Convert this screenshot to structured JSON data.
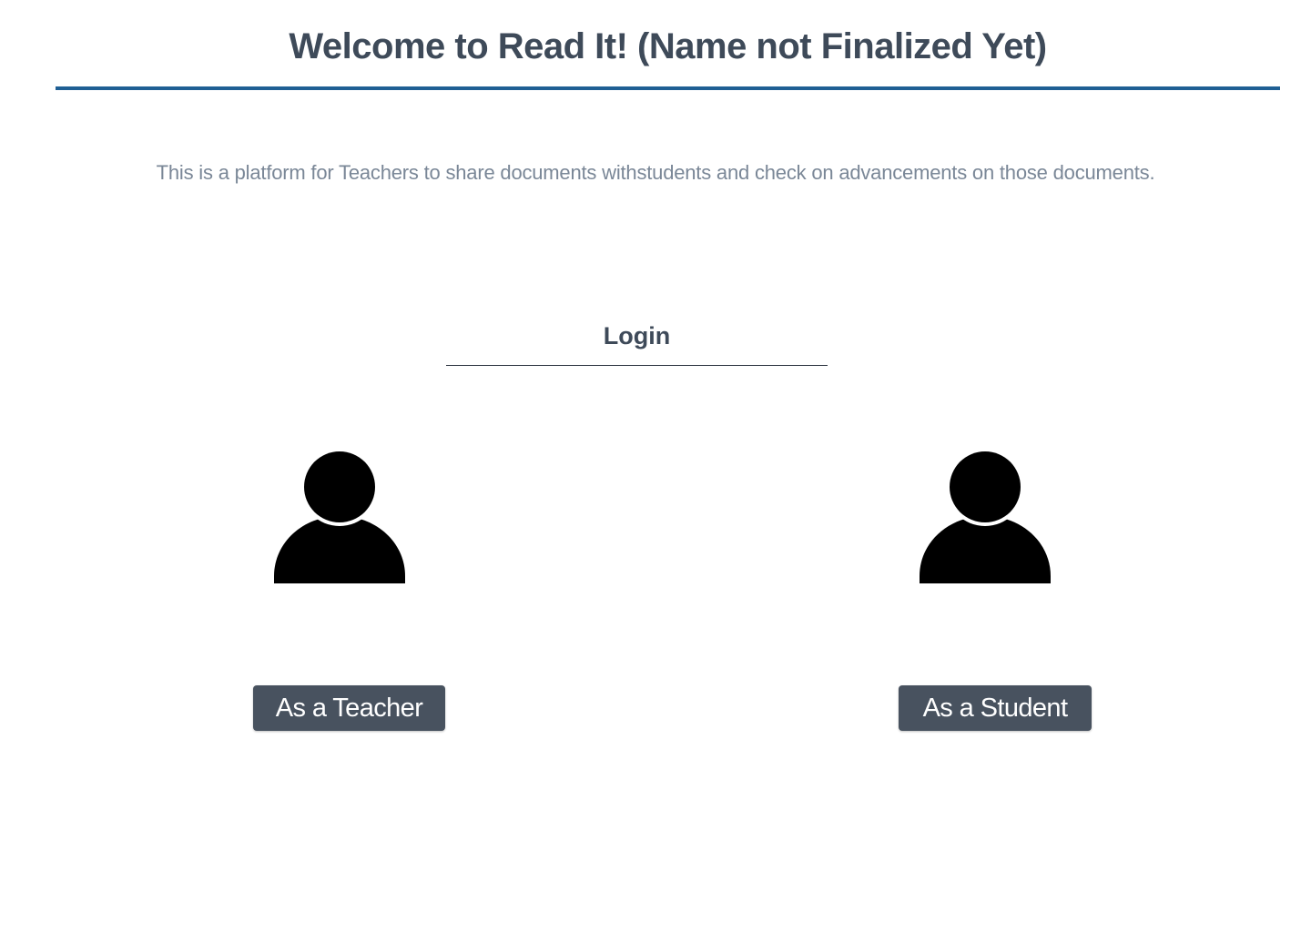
{
  "header": {
    "title": "Welcome to Read It! (Name not Finalized Yet)"
  },
  "intro": {
    "description": "This is a platform for Teachers to share documents withstudents and check on advancements on those documents."
  },
  "login": {
    "heading": "Login",
    "options": [
      {
        "icon": "user-icon",
        "label": "As a Teacher"
      },
      {
        "icon": "user-icon",
        "label": "As a Student"
      }
    ]
  },
  "colors": {
    "header_rule": "#1f5f94",
    "title_text": "#3e4a59",
    "description_text": "#7a8797",
    "button_bg": "#48525f",
    "button_text": "#ffffff",
    "icon": "#000000"
  }
}
